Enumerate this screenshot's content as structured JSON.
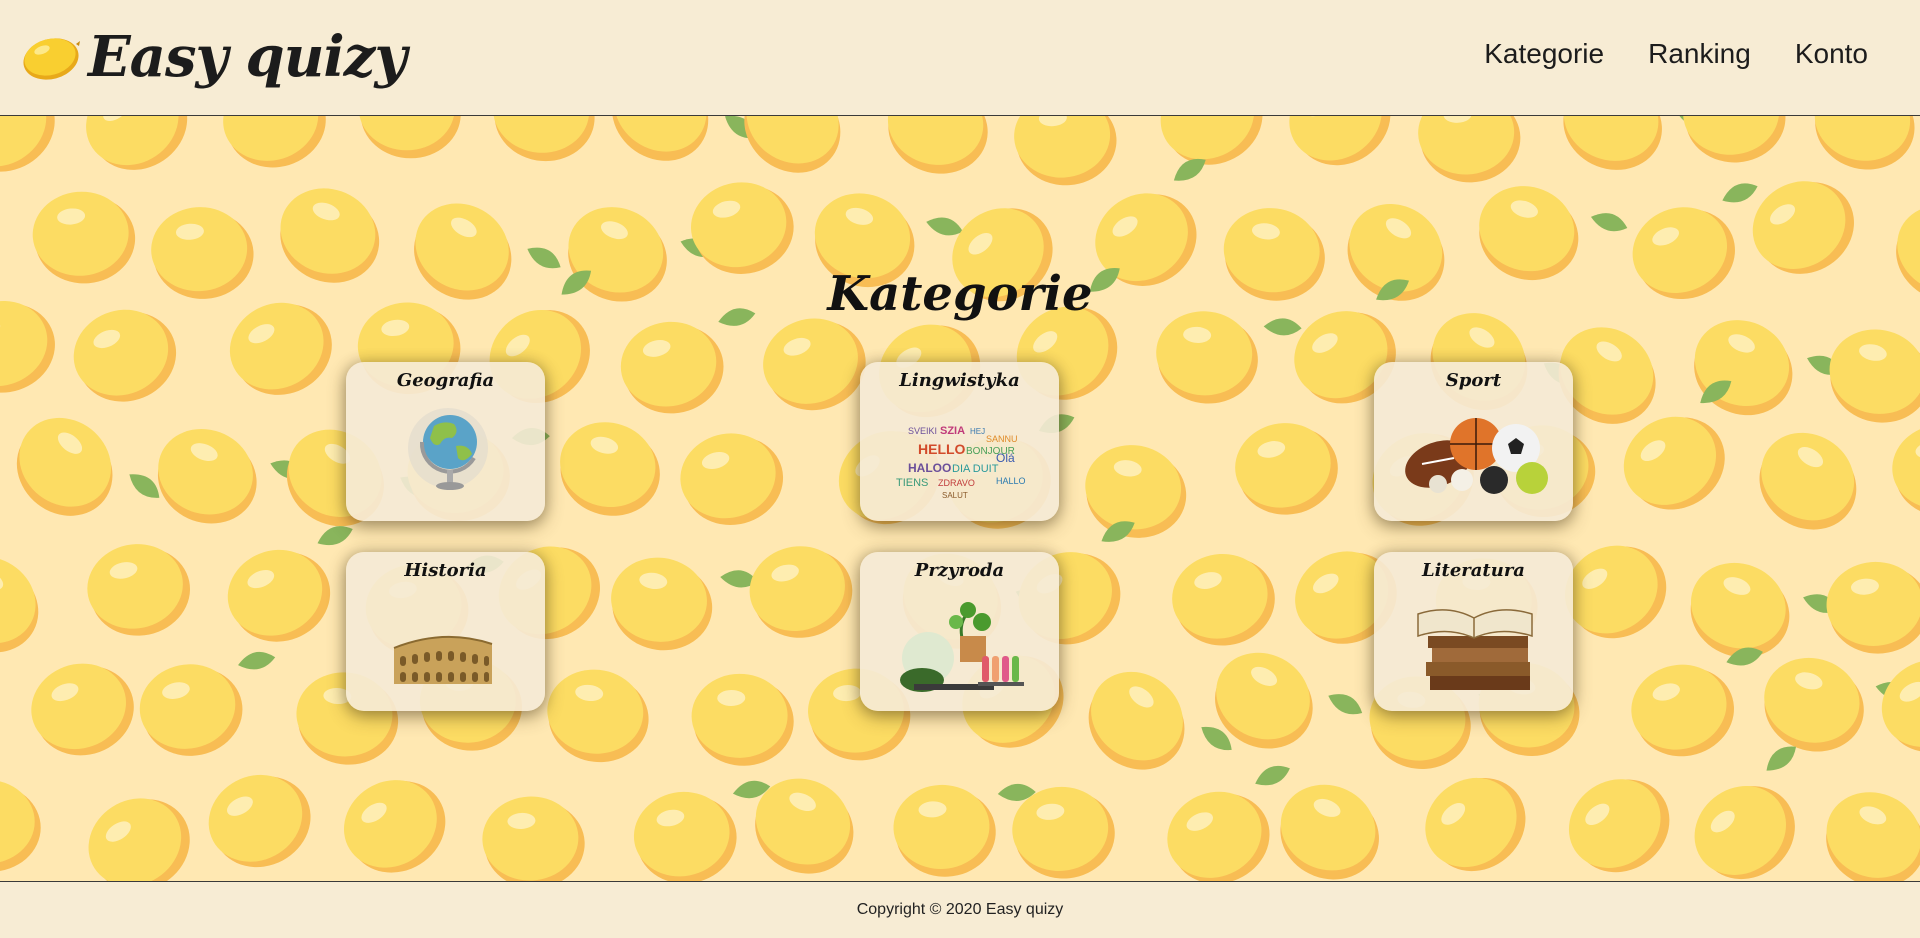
{
  "header": {
    "logo_text": "Easy quizy",
    "nav": [
      {
        "label": "Kategorie"
      },
      {
        "label": "Ranking"
      },
      {
        "label": "Konto"
      }
    ]
  },
  "main": {
    "title": "Kategorie",
    "categories": [
      {
        "label": "Geografia",
        "icon": "globe-icon"
      },
      {
        "label": "Lingwistyka",
        "icon": "word-cloud-icon"
      },
      {
        "label": "Sport",
        "icon": "sport-balls-icon"
      },
      {
        "label": "Historia",
        "icon": "colosseum-icon"
      },
      {
        "label": "Przyroda",
        "icon": "science-lab-icon"
      },
      {
        "label": "Literatura",
        "icon": "books-icon"
      }
    ]
  },
  "footer": {
    "copyright": "Copyright © 2020 Easy quizy"
  },
  "colors": {
    "header_bg": "#f7ecd4",
    "main_bg": "#ffe9b3",
    "lemon": "#fbd63a",
    "lemon_shade": "#f5a623",
    "leaf": "#4a9a2e"
  }
}
